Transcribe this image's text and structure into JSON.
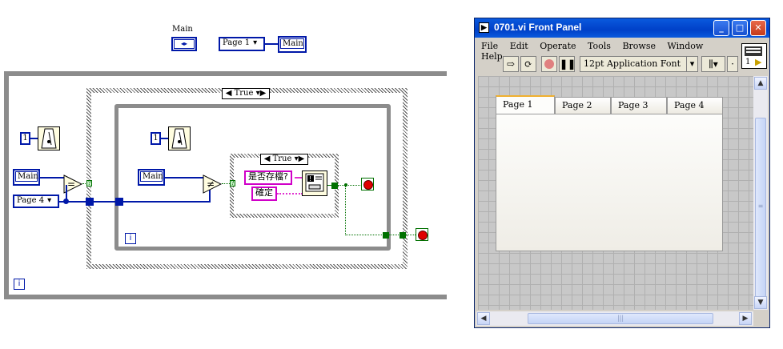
{
  "diagram": {
    "top_main_label": "Main",
    "page_ring_label": "Page 1",
    "top_main_indicator": "Main",
    "outer_case_selector": "True",
    "inner_case_selector": "True",
    "const_one_left": "1",
    "const_one_inner": "1",
    "main_ctrl_left": "Main",
    "main_ctrl_inner": "Main",
    "page4_ring": "Page 4",
    "save_prompt": "是否存檔?",
    "confirm_label": "確定",
    "iter_terminal": "i",
    "eq_symbol": "=",
    "neq_symbol": "≠",
    "cond_q": "?"
  },
  "front_panel": {
    "title": "0701.vi Front Panel",
    "menu": [
      "File",
      "Edit",
      "Operate",
      "Tools",
      "Browse",
      "Window",
      "Help"
    ],
    "font_ring": "12pt Application Font",
    "tabs": [
      "Page 1",
      "Page 2",
      "Page 3",
      "Page 4"
    ],
    "active_tab": "Page 1",
    "icon_label": "1"
  }
}
